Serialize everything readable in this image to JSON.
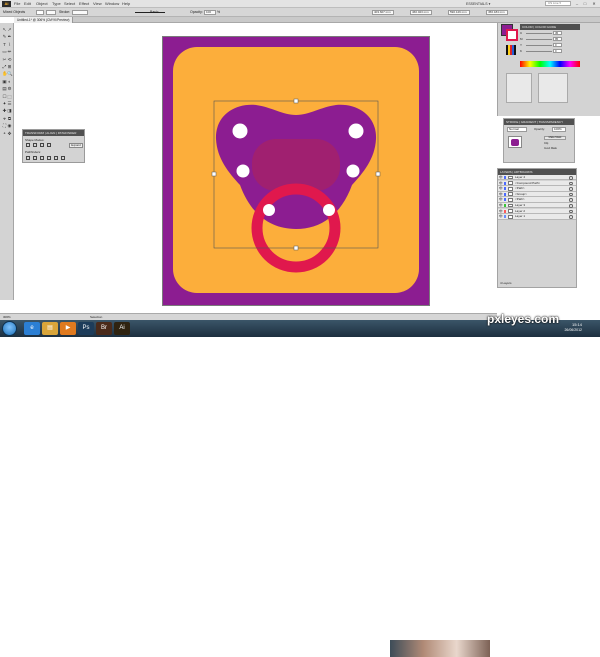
{
  "app": {
    "logo": "Ai",
    "window_title": "Untitled-1* @ 306% (CMYK/Preview)"
  },
  "menu": [
    "File",
    "Edit",
    "Object",
    "Type",
    "Select",
    "Effect",
    "View",
    "Window",
    "Help"
  ],
  "workspace_switcher": "ESSENTIALS ▾",
  "search": {
    "placeholder": "CS Live ▾"
  },
  "window_controls": [
    "–",
    "□",
    "✕"
  ],
  "control_bar": {
    "selection_label": "Mixed Objects",
    "stroke_label": "Stroke:",
    "style_label": "Basic",
    "opacity_label": "Opacity:",
    "opacity_value": "100",
    "opacity_unit": "%",
    "x_value": "403.607 mm",
    "y_value": "460.023 mm",
    "w_value": "590.129 mm",
    "h_value": "456.184 mm"
  },
  "document_tab": "Untitled-1* @ 306% (CMYK/Preview)",
  "tools": [
    "↖",
    "↗",
    "✎",
    "✒",
    "T",
    "\\",
    "▭",
    "✏",
    "✂",
    "⟲",
    "⤢",
    "⊞",
    "✋",
    "🔍",
    "▣",
    "◐",
    "▤",
    "⚙",
    "☐",
    "⬚",
    "✦",
    "☰",
    "✚",
    "◨",
    "⌖",
    "⧉",
    "⛶",
    "◉",
    "⚬",
    "✥"
  ],
  "panels": {
    "color": {
      "tabs": [
        "COLOR",
        "COLOR GUIDE"
      ],
      "channels": [
        {
          "label": "C",
          "value": "45"
        },
        {
          "label": "M",
          "value": "95"
        },
        {
          "label": "Y",
          "value": "0"
        },
        {
          "label": "K",
          "value": "0"
        }
      ]
    },
    "transparency": {
      "tabs": [
        "STROKE",
        "GRADIENT",
        "TRANSPARENCY"
      ],
      "blend_mode": "Normal",
      "opacity_label": "Opacity:",
      "opacity_value": "100%",
      "buttons": [
        "Make Mask",
        "Clip",
        "Invert Mask"
      ]
    },
    "pathfinder": {
      "tabs": [
        "TRANSFORM",
        "ALIGN",
        "PATHFINDER"
      ],
      "shape_modes_label": "Shape Modes:",
      "expand_label": "Expand",
      "pathfinders_label": "Pathfinders:"
    },
    "layers": {
      "tabs": [
        "LAYERS",
        "ARTBOARDS"
      ],
      "items": [
        {
          "name": "Layer 4",
          "color": "#4d6cff"
        },
        {
          "name": "<Compound Path>",
          "color": "#4d6cff"
        },
        {
          "name": "<Path>",
          "color": "#4d6cff"
        },
        {
          "name": "<Group>",
          "color": "#4d6cff"
        },
        {
          "name": "<Path>",
          "color": "#4d6cff"
        },
        {
          "name": "Layer 3",
          "color": "#39c639"
        },
        {
          "name": "Layer 2",
          "color": "#ff5a5a"
        },
        {
          "name": "Layer 1",
          "color": "#6a8cff"
        }
      ],
      "footer": "4 Layers"
    }
  },
  "status": {
    "zoom": "306%",
    "tool": "Selection"
  },
  "artwork_colors": {
    "background": "#8c1d91",
    "tile": "#fcae3b",
    "pacifier": "#8c1d91",
    "mouth": "#a02070",
    "ring": "#e0184d",
    "dots": "#ffffff"
  },
  "taskbar": {
    "apps": [
      {
        "icon": "ie-icon",
        "glyph": "e",
        "color": "#2b7fd4"
      },
      {
        "icon": "folder-icon",
        "glyph": "▤",
        "color": "#d9a53a"
      },
      {
        "icon": "media-icon",
        "glyph": "▶",
        "color": "#e07a1f"
      },
      {
        "icon": "photoshop-icon",
        "glyph": "Ps",
        "color": "#1d3c5a"
      },
      {
        "icon": "bridge-icon",
        "glyph": "Br",
        "color": "#4a2a1a"
      },
      {
        "icon": "illustrator-icon",
        "glyph": "Ai",
        "color": "#2f2310"
      }
    ],
    "clock": {
      "time": "15:14",
      "date": "26/06/2012"
    }
  },
  "watermark": "pxleyes.com"
}
